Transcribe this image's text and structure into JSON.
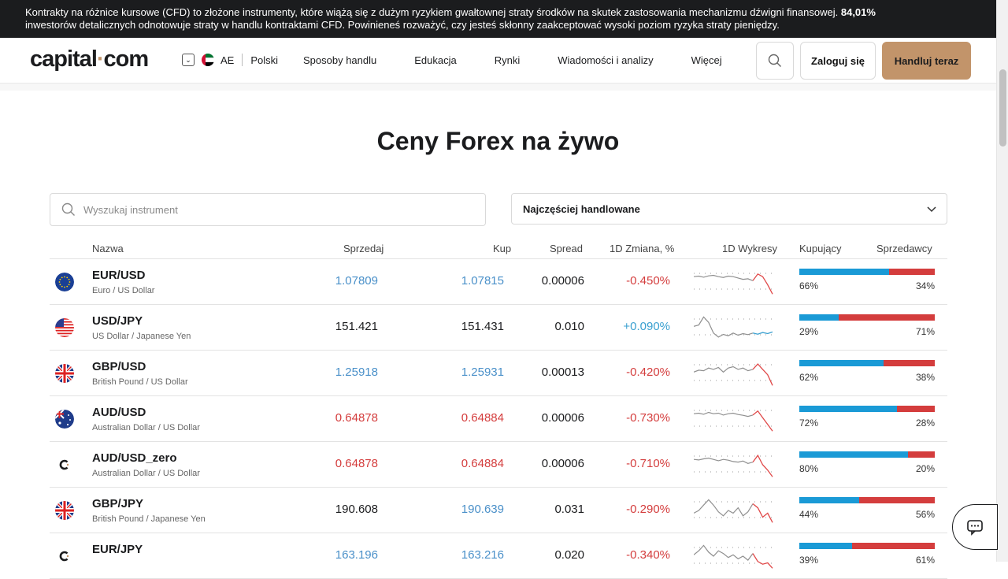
{
  "risk_banner": {
    "text": "Kontrakty na różnice kursowe (CFD) to złożone instrumenty, które wiążą się z dużym ryzykiem gwałtownej straty środków na skutek zastosowania mechanizmu dźwigni finansowej.",
    "pct": "84,01%",
    "text2": "inwestorów detalicznych odnotowuje straty w handlu kontraktami CFD. Powinieneś rozważyć, czy jesteś skłonny zaakceptować wysoki poziom ryzyka straty pieniędzy."
  },
  "nav": {
    "logo_main": "capital",
    "logo_dot": "·",
    "logo_end": "com",
    "region": "AE",
    "language": "Polski",
    "items": [
      "Sposoby handlu",
      "Edukacja",
      "Rynki",
      "Wiadomości i analizy",
      "Więcej"
    ],
    "login": "Zaloguj się",
    "trade": "Handluj teraz"
  },
  "page_title": "Ceny Forex na żywo",
  "search": {
    "placeholder": "Wyszukaj instrument"
  },
  "sort": {
    "selected": "Najczęściej handlowane"
  },
  "table": {
    "headers": {
      "name": "Nazwa",
      "sell": "Sprzedaj",
      "buy": "Kup",
      "spread": "Spread",
      "change": "1D Zmiana, %",
      "chart": "1D Wykresy",
      "buyers": "Kupujący",
      "sellers": "Sprzedawcy"
    },
    "rows": [
      {
        "symbol": "EUR/USD",
        "desc": "Euro / US Dollar",
        "sell": "1.07809",
        "buy": "1.07815",
        "spread": "0.00006",
        "change": "-0.450%",
        "buyers": "66%",
        "sellers": "34%",
        "buyers_frac": 0.66,
        "flag": "eu-flag-icon",
        "price_color": "blue",
        "change_dir": "down"
      },
      {
        "symbol": "USD/JPY",
        "desc": "US Dollar / Japanese Yen",
        "sell": "151.421",
        "buy": "151.431",
        "spread": "0.010",
        "change": "+0.090%",
        "buyers": "29%",
        "sellers": "71%",
        "buyers_frac": 0.29,
        "flag": "us-flag-icon",
        "price_color": "black",
        "change_dir": "up"
      },
      {
        "symbol": "GBP/USD",
        "desc": "British Pound / US Dollar",
        "sell": "1.25918",
        "buy": "1.25931",
        "spread": "0.00013",
        "change": "-0.420%",
        "buyers": "62%",
        "sellers": "38%",
        "buyers_frac": 0.62,
        "flag": "uk-flag-icon",
        "price_color": "blue",
        "change_dir": "down"
      },
      {
        "symbol": "AUD/USD",
        "desc": "Australian Dollar / US Dollar",
        "sell": "0.64878",
        "buy": "0.64884",
        "spread": "0.00006",
        "change": "-0.730%",
        "buyers": "72%",
        "sellers": "28%",
        "buyers_frac": 0.72,
        "flag": "au-flag-icon",
        "price_color": "red",
        "change_dir": "down"
      },
      {
        "symbol": "AUD/USD_zero",
        "desc": "Australian Dollar / US Dollar",
        "sell": "0.64878",
        "buy": "0.64884",
        "spread": "0.00006",
        "change": "-0.710%",
        "buyers": "80%",
        "sellers": "20%",
        "buyers_frac": 0.8,
        "flag": "capital-logo-icon",
        "price_color": "red",
        "change_dir": "down"
      },
      {
        "symbol": "GBP/JPY",
        "desc": "British Pound / Japanese Yen",
        "sell": "190.608",
        "buy": "190.639",
        "spread": "0.031",
        "change": "-0.290%",
        "buyers": "44%",
        "sellers": "56%",
        "buyers_frac": 0.44,
        "flag": "uk-flag-icon",
        "price_color": "mixed",
        "change_dir": "down"
      },
      {
        "symbol": "EUR/JPY",
        "desc": "",
        "sell": "163.196",
        "buy": "163.216",
        "spread": "0.020",
        "change": "-0.340%",
        "buyers": "39%",
        "sellers": "61%",
        "buyers_frac": 0.39,
        "flag": "capital-logo-icon",
        "price_color": "blue",
        "change_dir": "down"
      }
    ]
  },
  "colors": {
    "accent": "#c2946a",
    "buyers": "#1a9ad6",
    "sellers": "#d43d3d",
    "banner": "#1b1c1e"
  }
}
